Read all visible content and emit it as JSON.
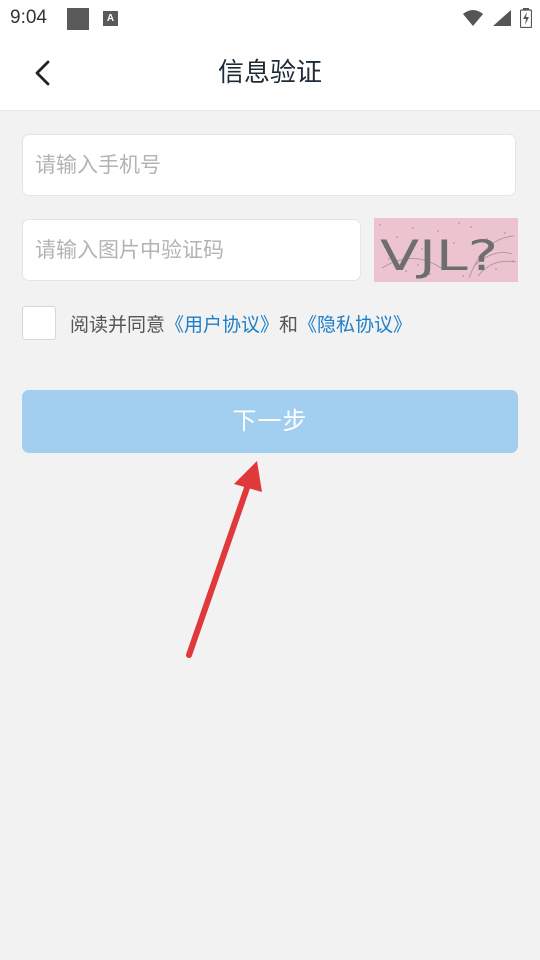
{
  "status_bar": {
    "time": "9:04",
    "a_icon_letter": "A"
  },
  "header": {
    "title": "信息验证"
  },
  "form": {
    "phone_placeholder": "请输入手机号",
    "captcha_placeholder": "请输入图片中验证码",
    "captcha_text": "VJL?"
  },
  "agreement": {
    "prefix": "阅读并同意",
    "user_agreement": "《用户协议》",
    "connector": "和",
    "privacy_agreement": "《隐私协议》"
  },
  "next_button": {
    "label": "下一步"
  },
  "colors": {
    "link": "#1e7ec8",
    "button_disabled": "#a2cff0",
    "arrow": "#e0393c",
    "captcha_bg": "#ecc4d0"
  }
}
